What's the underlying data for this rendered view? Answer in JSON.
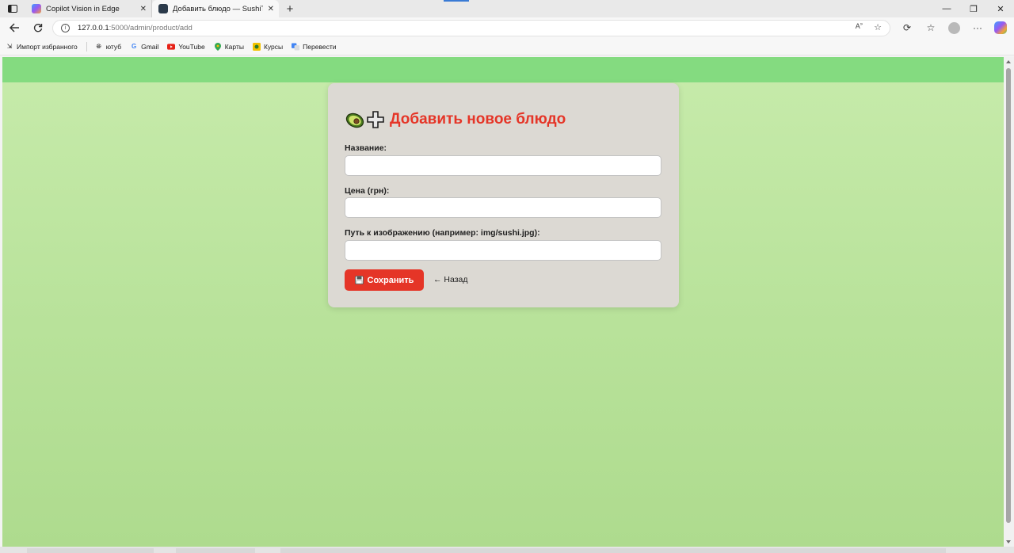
{
  "browser": {
    "tabs": [
      {
        "title": "Copilot Vision in Edge",
        "active": false
      },
      {
        "title": "Добавить блюдо — SushiTime",
        "active": true
      }
    ],
    "address": {
      "host": "127.0.0.1",
      "path": ":5000/admin/product/add"
    },
    "bookmarks": [
      {
        "label": "Импорт избранного",
        "icon": "import-icon"
      },
      {
        "label": "ютуб",
        "icon": "globe-icon"
      },
      {
        "label": "Gmail",
        "icon": "google-icon"
      },
      {
        "label": "YouTube",
        "icon": "youtube-icon"
      },
      {
        "label": "Карты",
        "icon": "maps-pin-icon"
      },
      {
        "label": "Курсы",
        "icon": "courses-icon"
      },
      {
        "label": "Перевести",
        "icon": "translate-icon"
      }
    ]
  },
  "page": {
    "title": "Добавить новое блюдо",
    "title_icons": [
      "avocado-icon",
      "plus-icon"
    ],
    "fields": [
      {
        "label": "Название:",
        "value": "",
        "name": "name"
      },
      {
        "label": "Цена (грн):",
        "value": "",
        "name": "price"
      },
      {
        "label": "Путь к изображению (например: img/sushi.jpg):",
        "value": "",
        "name": "image"
      }
    ],
    "save_label": "Сохранить",
    "back_label": "← Назад"
  },
  "colors": {
    "header": "#84db80",
    "background_top": "#c7ebab",
    "background_bottom": "#aedb8e",
    "card": "#dcd9d3",
    "accent": "#e53527"
  }
}
